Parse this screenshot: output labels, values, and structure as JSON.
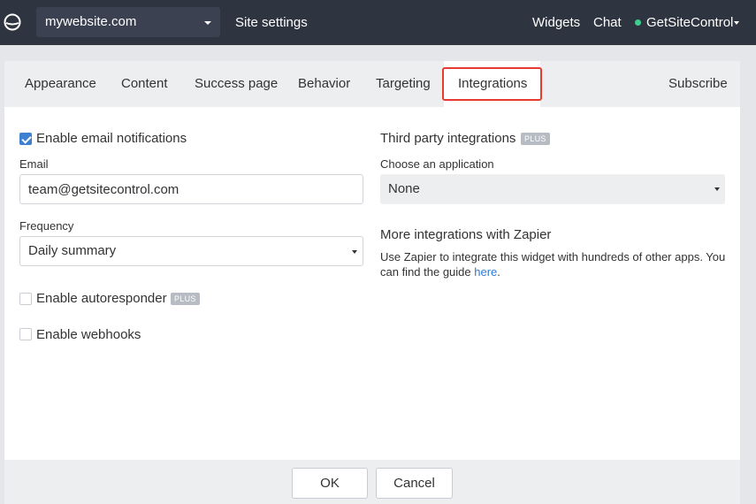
{
  "topbar": {
    "site_name": "mywebsite.com",
    "site_settings": "Site settings",
    "widgets": "Widgets",
    "chat": "Chat",
    "account": "GetSiteControl"
  },
  "tabs": [
    {
      "label": "Appearance"
    },
    {
      "label": "Content"
    },
    {
      "label": "Success page"
    },
    {
      "label": "Behavior"
    },
    {
      "label": "Targeting"
    },
    {
      "label": "Integrations"
    },
    {
      "label": "Subscribe"
    }
  ],
  "active_tab": "Integrations",
  "email_notifications": {
    "label": "Enable email notifications",
    "checked": true,
    "email_label": "Email",
    "email_value": "team@getsitecontrol.com",
    "frequency_label": "Frequency",
    "frequency_value": "Daily summary"
  },
  "autoresponder": {
    "label": "Enable autoresponder",
    "badge": "PLUS",
    "checked": false
  },
  "webhooks": {
    "label": "Enable webhooks",
    "checked": false
  },
  "third_party": {
    "heading": "Third party integrations",
    "badge": "PLUS",
    "choose_label": "Choose an application",
    "selected": "None"
  },
  "zapier": {
    "heading": "More integrations with Zapier",
    "text": "Use Zapier to integrate this widget with hundreds of other apps. You can find the guide ",
    "link": "here",
    "end": "."
  },
  "footer": {
    "ok": "OK",
    "cancel": "Cancel"
  },
  "colors": {
    "topbar": "#2f3441",
    "accent": "#3d7fd0",
    "highlight": "#e83a2f",
    "status": "#3ecf8e"
  }
}
